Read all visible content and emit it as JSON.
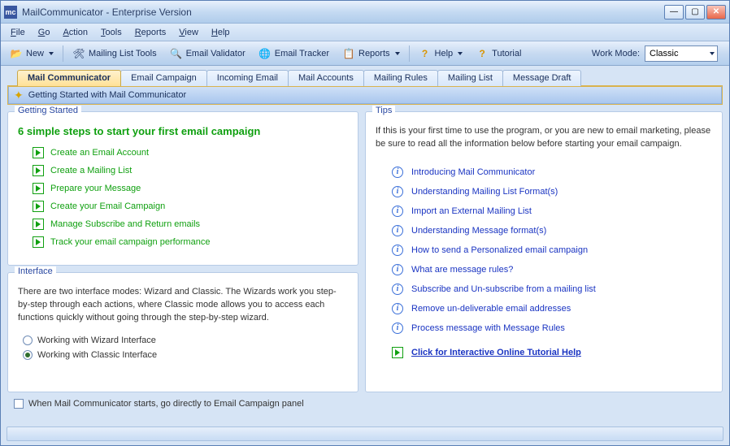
{
  "window": {
    "title": "MailCommunicator - Enterprise Version",
    "icon_text": "mc"
  },
  "menubar": [
    "File",
    "Go",
    "Action",
    "Tools",
    "Reports",
    "View",
    "Help"
  ],
  "toolbar": {
    "new": "New",
    "mailing_list_tools": "Mailing List Tools",
    "email_validator": "Email Validator",
    "email_tracker": "Email Tracker",
    "reports": "Reports",
    "help": "Help",
    "tutorial": "Tutorial",
    "work_mode_label": "Work Mode:",
    "work_mode_value": "Classic"
  },
  "tabs": [
    "Mail Communicator",
    "Email Campaign",
    "Incoming Email",
    "Mail Accounts",
    "Mailing Rules",
    "Mailing List",
    "Message Draft"
  ],
  "active_tab_index": 0,
  "sub_banner": "Getting Started with Mail Communicator",
  "getting_started": {
    "legend": "Getting Started",
    "title": "6 simple steps to start your first email campaign",
    "steps": [
      "Create an Email Account",
      "Create a Mailing List",
      "Prepare your Message",
      "Create your Email Campaign",
      "Manage Subscribe and Return emails",
      "Track your email campaign performance"
    ]
  },
  "interface_panel": {
    "legend": "Interface",
    "text": "There are two interface modes: Wizard and Classic. The Wizards work you step-by-step through each actions, where Classic mode allows you to access each functions quickly without going through the step-by-step wizard.",
    "option_wizard": "Working with Wizard Interface",
    "option_classic": "Working with Classic Interface",
    "selected": "classic"
  },
  "tips_panel": {
    "legend": "Tips",
    "text": "If this is your first time to use the program, or you are new to email marketing, please be sure to read all the information below before starting your email campaign.",
    "links": [
      "Introducing Mail Communicator",
      "Understanding Mailing List Format(s)",
      "Import an External Mailing List",
      "Understanding Message format(s)",
      "How to send a Personalized email campaign",
      "What are message rules?",
      "Subscribe and Un-subscribe from a mailing list",
      "Remove un-deliverable email addresses",
      "Process message with Message Rules"
    ],
    "tutorial_link": "Click for Interactive Online Tutorial Help"
  },
  "bottom_checkbox": "When Mail Communicator starts, go directly to Email Campaign panel"
}
